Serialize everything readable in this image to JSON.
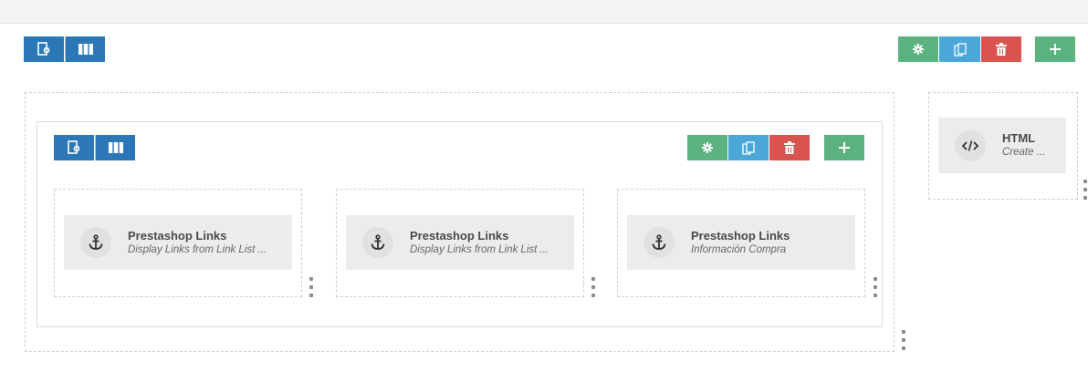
{
  "modules": [
    {
      "title": "Prestashop Links",
      "description": "Display Links from Link List ...",
      "icon": "anchor-icon"
    },
    {
      "title": "Prestashop Links",
      "description": "Display Links from Link List ...",
      "icon": "anchor-icon"
    },
    {
      "title": "Prestashop Links",
      "description": "Información Compra",
      "icon": "anchor-icon"
    },
    {
      "title": "HTML",
      "description": "Create ...",
      "icon": "code-icon"
    }
  ],
  "colors": {
    "blue": "#2c78b6",
    "green": "#5cb37f",
    "lightblue": "#4aa7d8",
    "red": "#d9534f"
  }
}
